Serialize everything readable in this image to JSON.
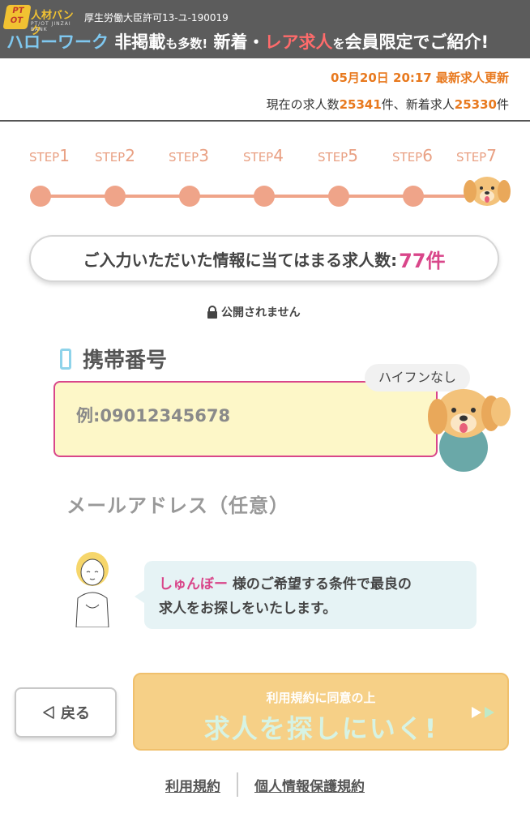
{
  "banner": {
    "logo_top": "PT",
    "logo_bottom": "OT",
    "logo_name": "人材バンク",
    "logo_sub": "PT/OT JINZAI BANK",
    "permit": "厚生労働大臣許可13-ユ-190019",
    "headline_part1": "ハローワーク",
    "headline_part2": "非掲載",
    "headline_part3": "も多数!",
    "headline_part4": "新着・",
    "headline_part5": "レア求人",
    "headline_part6": "を",
    "headline_part7": "会員限定でご紹介!"
  },
  "update": {
    "datetime": "05月20日 20:17",
    "label": "最新求人更新",
    "counts_prefix": "現在の求人数",
    "total": "25341",
    "counts_mid": "件、新着求人",
    "new": "25330",
    "counts_suffix": "件"
  },
  "steps": [
    {
      "prefix": "STEP",
      "num": "1"
    },
    {
      "prefix": "STEP",
      "num": "2"
    },
    {
      "prefix": "STEP",
      "num": "3"
    },
    {
      "prefix": "STEP",
      "num": "4"
    },
    {
      "prefix": "STEP",
      "num": "5"
    },
    {
      "prefix": "STEP",
      "num": "6"
    },
    {
      "prefix": "STEP",
      "num": "7"
    }
  ],
  "result": {
    "text": "ご入力いただいた情報に当てはまる求人数:",
    "count": "77件"
  },
  "private_note": "公開されません",
  "phone": {
    "label": "携帯番号",
    "placeholder": "例:09012345678",
    "hint": "ハイフンなし"
  },
  "email": {
    "label": "メールアドレス（任意）"
  },
  "advisor": {
    "name": "しゅんぼー",
    "line1_rest": "様のご希望する条件で最良の",
    "line2": "求人をお探しをいたします。"
  },
  "buttons": {
    "back": "戻る",
    "submit_sub": "利用規約に同意の上",
    "submit_main": "求人を探しにいく!"
  },
  "footer": {
    "terms": "利用規約",
    "privacy": "個人情報保護規約"
  },
  "colors": {
    "accent_orange": "#e8791e",
    "accent_pink": "#d9468a",
    "step_salmon": "#efa489",
    "submit_yellow": "#f6d087"
  }
}
